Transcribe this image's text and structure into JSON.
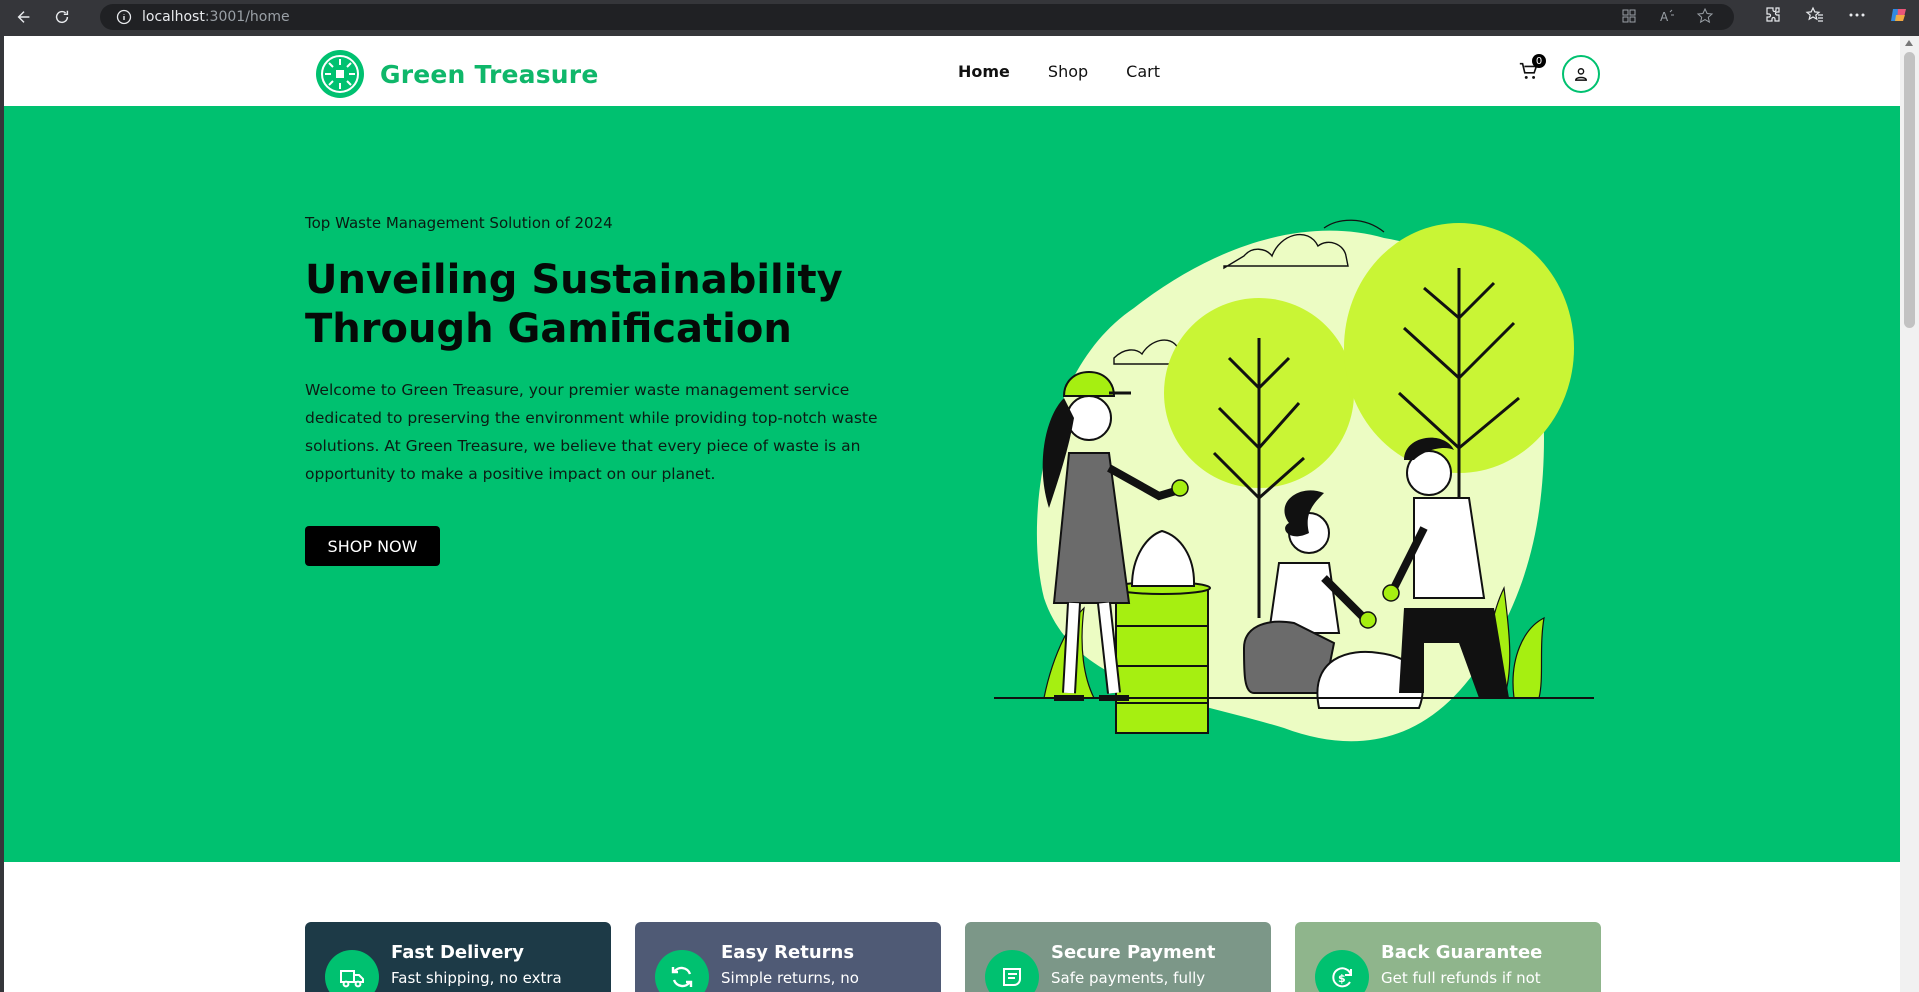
{
  "browser": {
    "url_host": "localhost",
    "url_rest": ":3001/home",
    "icons": [
      "back-icon",
      "reload-icon",
      "site-info-icon",
      "apps-icon",
      "read-aloud-icon",
      "favorite-star-icon",
      "extensions-icon",
      "favorites-icon",
      "more-icon",
      "copilot-icon"
    ]
  },
  "header": {
    "brand": "Green Treasure",
    "nav": [
      {
        "label": "Home",
        "active": true
      },
      {
        "label": "Shop",
        "active": false
      },
      {
        "label": "Cart",
        "active": false
      }
    ],
    "cart_count": "0"
  },
  "hero": {
    "eyebrow": "Top Waste Management Solution of 2024",
    "title_line1": "Unveiling Sustainability",
    "title_line2": "Through Gamification",
    "description": "Welcome to Green Treasure, your premier waste management service dedicated to preserving the environment while providing top-notch waste solutions. At Green Treasure, we believe that every piece of waste is an opportunity to make a positive impact on our planet.",
    "cta": "SHOP NOW"
  },
  "features": [
    {
      "title": "Fast Delivery",
      "subtitle": "Fast shipping, no extra",
      "icon": "truck-icon",
      "color": "#1d3a47"
    },
    {
      "title": "Easy Returns",
      "subtitle": "Simple returns, no",
      "icon": "refresh-icon",
      "color": "#4f5a75"
    },
    {
      "title": "Secure Payment",
      "subtitle": "Safe payments, fully",
      "icon": "payment-card-icon",
      "color": "#7c9788"
    },
    {
      "title": "Back Guarantee",
      "subtitle": "Get full refunds if not",
      "icon": "money-back-icon",
      "color": "#8fb58c"
    }
  ],
  "colors": {
    "brand": "#00c170",
    "brand_text": "#0fb76a",
    "button": "#000000"
  }
}
